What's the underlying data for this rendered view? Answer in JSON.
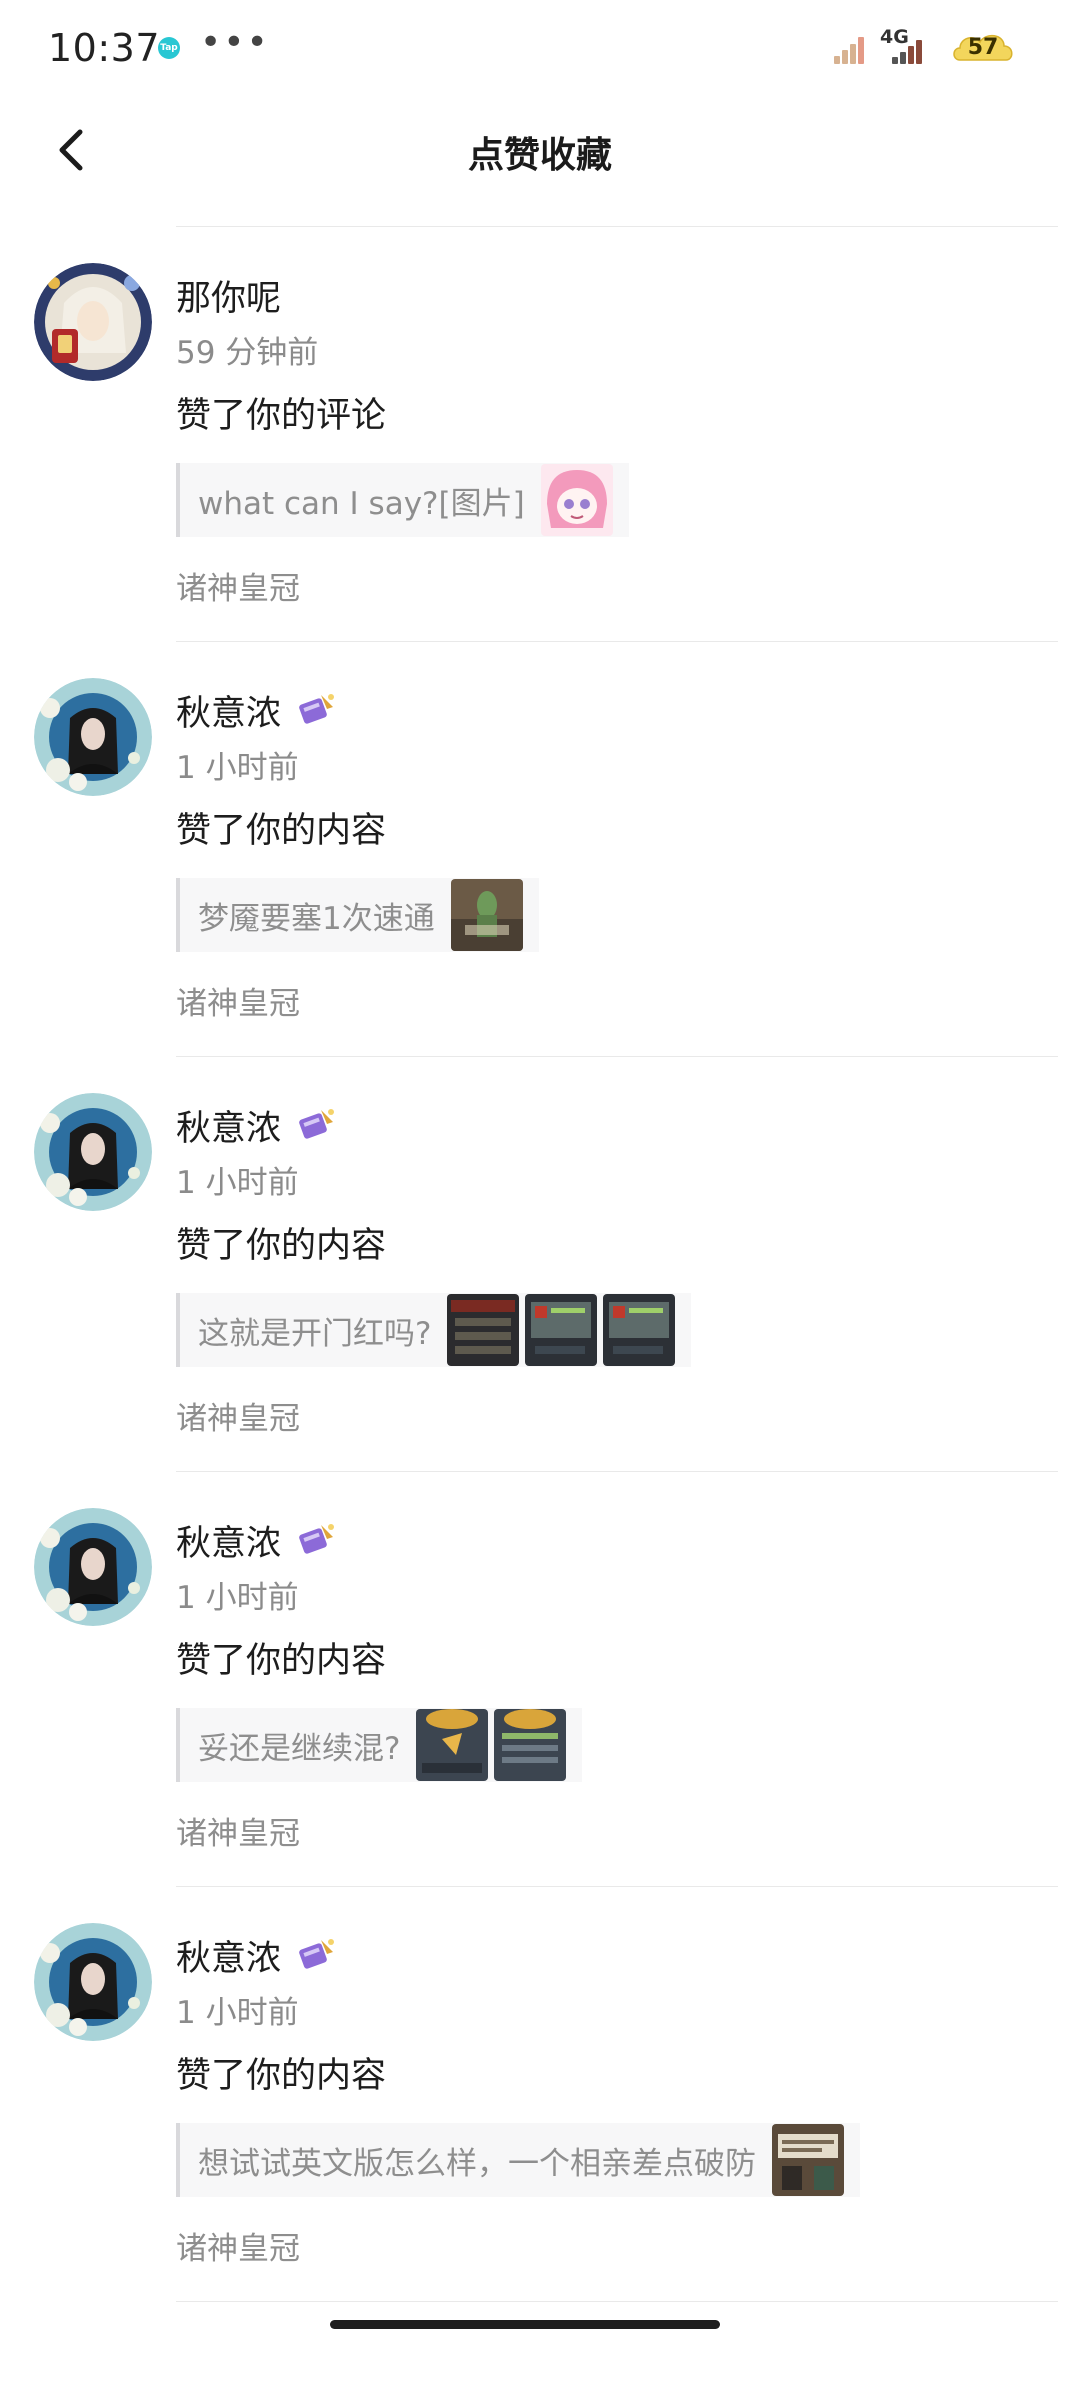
{
  "status_bar": {
    "time": "10:37",
    "app_icon": "tap-app-icon",
    "more": "•••",
    "network": "4G",
    "battery": "57"
  },
  "header": {
    "title": "点赞收藏",
    "back_icon": "chevron-left-icon"
  },
  "notifications": [
    {
      "user": "那你呢",
      "time": "59 分钟前",
      "action": "赞了你的评论",
      "quote": "what can I say?[图片]",
      "source": "诸神皇冠",
      "has_badge": false,
      "thumbnails": [
        "anime-sticker"
      ]
    },
    {
      "user": "秋意浓",
      "time": "1 小时前",
      "action": "赞了你的内容",
      "quote": "梦魇要塞1次速通",
      "source": "诸神皇冠",
      "has_badge": true,
      "thumbnails": [
        "game-screenshot"
      ]
    },
    {
      "user": "秋意浓",
      "time": "1 小时前",
      "action": "赞了你的内容",
      "quote": "这就是开门红吗?",
      "source": "诸神皇冠",
      "has_badge": true,
      "thumbnails": [
        "game-screenshot",
        "game-screenshot",
        "game-screenshot"
      ]
    },
    {
      "user": "秋意浓",
      "time": "1 小时前",
      "action": "赞了你的内容",
      "quote": "妥还是继续混?",
      "source": "诸神皇冠",
      "has_badge": true,
      "thumbnails": [
        "game-screenshot",
        "game-screenshot"
      ]
    },
    {
      "user": "秋意浓",
      "time": "1 小时前",
      "action": "赞了你的内容",
      "quote": "想试试英文版怎么样，一个相亲差点破防",
      "source": "诸神皇冠",
      "has_badge": true,
      "thumbnails": [
        "game-screenshot"
      ]
    }
  ],
  "colors": {
    "text_primary": "#1d1d1d",
    "text_secondary": "#8e8e8e",
    "quote_bg": "#f7f7f8",
    "quote_border": "#d9d9dc",
    "divider": "#e9e9e9"
  }
}
